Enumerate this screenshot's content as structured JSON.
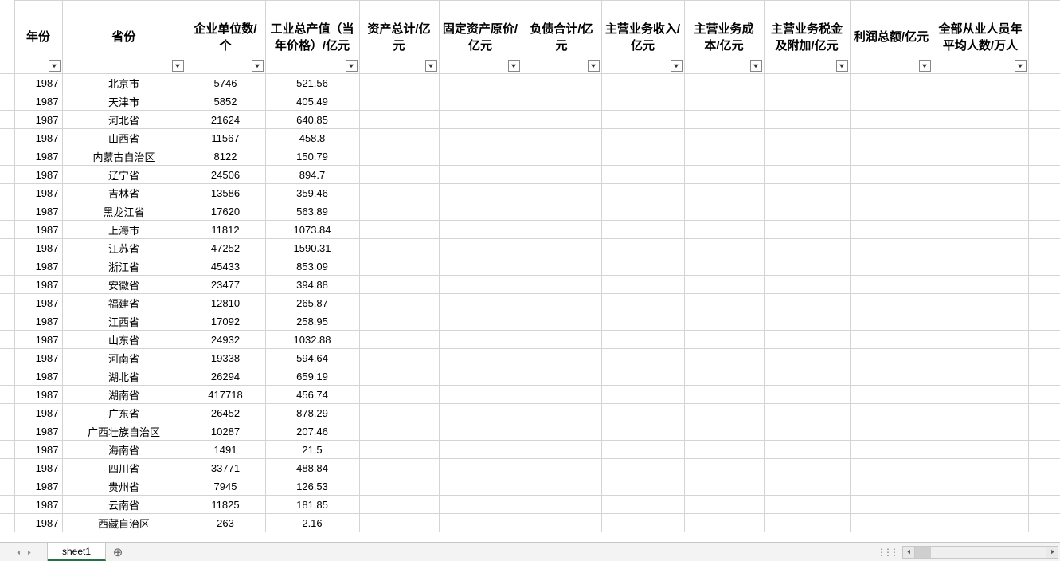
{
  "sheet": {
    "name": "sheet1"
  },
  "headers": [
    "年份",
    "省份",
    "企业单位数/个",
    "工业总产值（当年价格）/亿元",
    "资产总计/亿元",
    "固定资产原价/亿元",
    "负债合计/亿元",
    "主营业务收入/亿元",
    "主营业务成本/亿元",
    "主营业务税金及附加/亿元",
    "利润总额/亿元",
    "全部从业人员年平均人数/万人"
  ],
  "rows": [
    {
      "year": "1987",
      "province": "北京市",
      "units": "5746",
      "output": "521.56"
    },
    {
      "year": "1987",
      "province": "天津市",
      "units": "5852",
      "output": "405.49"
    },
    {
      "year": "1987",
      "province": "河北省",
      "units": "21624",
      "output": "640.85"
    },
    {
      "year": "1987",
      "province": "山西省",
      "units": "11567",
      "output": "458.8"
    },
    {
      "year": "1987",
      "province": "内蒙古自治区",
      "units": "8122",
      "output": "150.79"
    },
    {
      "year": "1987",
      "province": "辽宁省",
      "units": "24506",
      "output": "894.7"
    },
    {
      "year": "1987",
      "province": "吉林省",
      "units": "13586",
      "output": "359.46"
    },
    {
      "year": "1987",
      "province": "黑龙江省",
      "units": "17620",
      "output": "563.89"
    },
    {
      "year": "1987",
      "province": "上海市",
      "units": "11812",
      "output": "1073.84"
    },
    {
      "year": "1987",
      "province": "江苏省",
      "units": "47252",
      "output": "1590.31"
    },
    {
      "year": "1987",
      "province": "浙江省",
      "units": "45433",
      "output": "853.09"
    },
    {
      "year": "1987",
      "province": "安徽省",
      "units": "23477",
      "output": "394.88"
    },
    {
      "year": "1987",
      "province": "福建省",
      "units": "12810",
      "output": "265.87"
    },
    {
      "year": "1987",
      "province": "江西省",
      "units": "17092",
      "output": "258.95"
    },
    {
      "year": "1987",
      "province": "山东省",
      "units": "24932",
      "output": "1032.88"
    },
    {
      "year": "1987",
      "province": "河南省",
      "units": "19338",
      "output": "594.64"
    },
    {
      "year": "1987",
      "province": "湖北省",
      "units": "26294",
      "output": "659.19"
    },
    {
      "year": "1987",
      "province": "湖南省",
      "units": "417718",
      "output": "456.74"
    },
    {
      "year": "1987",
      "province": "广东省",
      "units": "26452",
      "output": "878.29"
    },
    {
      "year": "1987",
      "province": "广西壮族自治区",
      "units": "10287",
      "output": "207.46"
    },
    {
      "year": "1987",
      "province": "海南省",
      "units": "1491",
      "output": "21.5"
    },
    {
      "year": "1987",
      "province": "四川省",
      "units": "33771",
      "output": "488.84"
    },
    {
      "year": "1987",
      "province": "贵州省",
      "units": "7945",
      "output": "126.53"
    },
    {
      "year": "1987",
      "province": "云南省",
      "units": "11825",
      "output": "181.85"
    },
    {
      "year": "1987",
      "province": "西藏自治区",
      "units": "263",
      "output": "2.16"
    }
  ],
  "icons": {
    "filter_dropdown": "▾",
    "add_sheet": "⊕"
  }
}
